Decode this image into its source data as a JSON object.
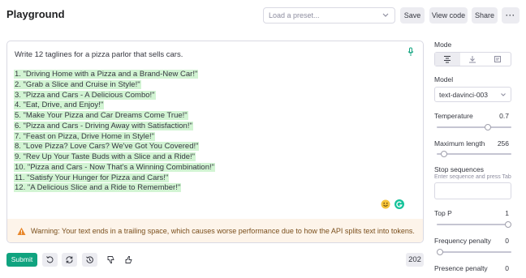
{
  "header": {
    "title": "Playground",
    "preset_placeholder": "Load a preset...",
    "save_label": "Save",
    "view_code_label": "View code",
    "share_label": "Share",
    "more_label": "···"
  },
  "editor": {
    "prompt": "Write 12 taglines for a pizza parlor that sells cars.",
    "completions": [
      "1. \"Driving Home with a Pizza and a Brand-New Car!\"",
      "2. \"Grab a Slice and Cruise in Style!\"",
      "3. \"Pizza and Cars - A Delicious Combo!\"",
      "4. \"Eat, Drive, and Enjoy!\"",
      "5. \"Make Your Pizza and Car Dreams Come True!\"",
      "6. \"Pizza and Cars - Driving Away with Satisfaction!\"",
      "7. \"Feast on Pizza, Drive Home in Style!\"",
      "8. \"Love Pizza? Love Cars? We've Got You Covered!\"",
      "9. \"Rev Up Your Taste Buds with a Slice and a Ride!\"",
      "10. \"Pizza and Cars - Now That's a Winning Combination!\"",
      "11. \"Satisfy Your Hunger for Pizza and Cars!\"",
      "12. \"A Delicious Slice and a Ride to Remember!\""
    ],
    "warning": "Warning: Your text ends in a trailing space, which causes worse performance due to how the API splits text into tokens."
  },
  "footer": {
    "submit_label": "Submit",
    "token_count": "202"
  },
  "settings": {
    "mode_label": "Mode",
    "model_label": "Model",
    "model_value": "text-davinci-003",
    "temperature_label": "Temperature",
    "temperature_value": "0.7",
    "temperature": 0.7,
    "max_length_label": "Maximum length",
    "max_length_value": "256",
    "max_length_fraction": 0.06,
    "stop_label": "Stop sequences",
    "stop_hint": "Enter sequence and press Tab",
    "top_p_label": "Top P",
    "top_p_value": "1",
    "top_p": 1,
    "freq_label": "Frequency penalty",
    "freq_value": "0",
    "freq": 0,
    "presence_label": "Presence penalty",
    "presence_value": "0"
  },
  "colors": {
    "accent": "#10a37f",
    "highlight": "#d2f4d3",
    "warning_bg": "#fdf4ea",
    "warning_icon": "#e8872b"
  },
  "icons": {
    "preset_chevron": "chevron-down-icon",
    "mic": "microphone-icon",
    "emoji": "smiley-icon",
    "grammarly": "grammarly-icon",
    "warning": "warning-triangle-icon",
    "undo": "undo-icon",
    "regenerate": "regenerate-icon",
    "history": "history-icon",
    "thumbs_down": "thumbs-down-icon",
    "thumbs_up": "thumbs-up-icon",
    "mode_complete": "complete-mode-icon",
    "mode_insert": "insert-mode-icon",
    "mode_edit": "edit-mode-icon"
  }
}
